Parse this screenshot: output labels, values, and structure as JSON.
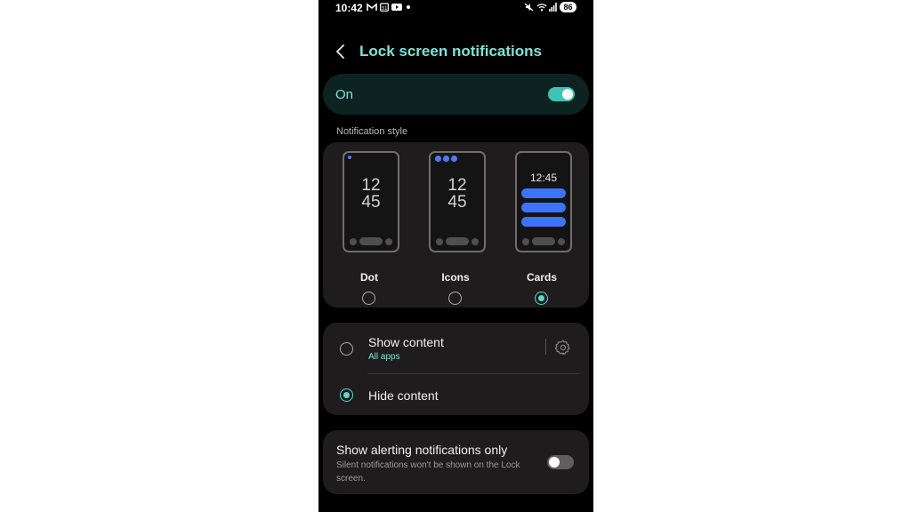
{
  "status_bar": {
    "time": "10:42",
    "battery": "86",
    "left_icons": [
      "gmail-icon",
      "calendar-icon",
      "youtube-icon",
      "dot-icon"
    ],
    "right_icons": [
      "mute-icon",
      "wifi-icon",
      "signal-icon"
    ]
  },
  "header": {
    "title": "Lock screen notifications",
    "back_icon": "chevron-left-icon"
  },
  "master_toggle": {
    "label": "On",
    "state": true
  },
  "notification_style": {
    "section_label": "Notification style",
    "selected": "Cards",
    "options": [
      {
        "label": "Dot",
        "preview_time": [
          "12",
          "45"
        ],
        "selected": false
      },
      {
        "label": "Icons",
        "preview_time": [
          "12",
          "45"
        ],
        "selected": false
      },
      {
        "label": "Cards",
        "preview_time": [
          "12:45"
        ],
        "selected": true
      }
    ]
  },
  "content": {
    "show": {
      "label": "Show content",
      "sublabel": "All apps",
      "selected": false,
      "settings_icon": "gear-icon"
    },
    "hide": {
      "label": "Hide content",
      "selected": true
    }
  },
  "alerting_only": {
    "title": "Show alerting notifications only",
    "description": "Silent notifications won't be shown on the Lock screen.",
    "state": false
  },
  "colors": {
    "accent": "#7fe3d8",
    "toggle_on": "#3ec4b6",
    "card_bg": "#1e1c1c",
    "preview_blue": "#3f72ff"
  }
}
